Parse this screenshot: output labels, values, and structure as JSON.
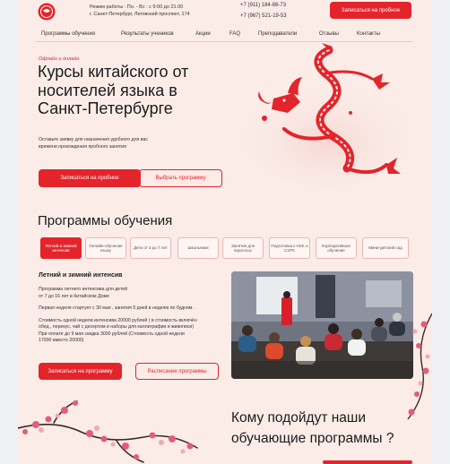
{
  "header": {
    "hours": "Режим работы : Пн. - Вс : с 9:00 до 21.00",
    "address": "г. Санкт-Петербург, Лиговский проспект, 174",
    "phone1": "+7 (911) 184-86-73",
    "phone2": "+7 (967) 521-19-53",
    "cta": "Записаться на пробное"
  },
  "nav": [
    "Программы обучения",
    "Результаты учеников",
    "Акции",
    "FAQ",
    "Преподаватели",
    "Отзывы",
    "Контакты"
  ],
  "hero": {
    "eyebrow": "Офлайн и онлайн",
    "title_line1": "Курсы китайского от",
    "title_line2": "носителей языка в",
    "title_line3": "Санкт-Петербурге",
    "subtitle_line1": "Оставьте заявку для назначения удобного для вас",
    "subtitle_line2": "времени прохождения пробного занятия",
    "primary_btn": "Записаться на пробное",
    "secondary_btn": "Выбрать программу"
  },
  "programs": {
    "heading": "Программы обучения",
    "tabs": [
      "Летний и зимний интенсив",
      "Онлайн-обучение языку",
      "Дети от 3 до 7 лет",
      "Школьники",
      "Занятия для взрослых",
      "Подготовка к HSK и СЭТК",
      "Корпоративное обучение",
      "Мини-детский сад"
    ],
    "card_title": "Летний и зимний интенсив",
    "p1_line1": "Программа летнего интенсива для детей",
    "p1_line2": "от 7 до 16 лет в Китайском Доме",
    "p2": "Первая неделя стартует с 30 мая , занятия 5 дней в неделю по будням .",
    "p3_line1": "Стоимость одной недели интенсива 20000 рублей ( в стоимость включён",
    "p3_line2": "обед , перекус, чай с десертом и наборы для каллиграфии и живописи)",
    "p3_line3": "При оплате до 9 мая скидка 3000 рублей (Стоимость одной недели",
    "p3_line4": "17000 вместо 20000)",
    "btn_signup": "Записаться на программу",
    "btn_schedule": "Расписание программы"
  },
  "audience": {
    "heading_line1": "Кому подойдут наши",
    "heading_line2": "обучающие программы ?"
  },
  "colors": {
    "accent": "#e3242b",
    "background": "#fbece8"
  }
}
